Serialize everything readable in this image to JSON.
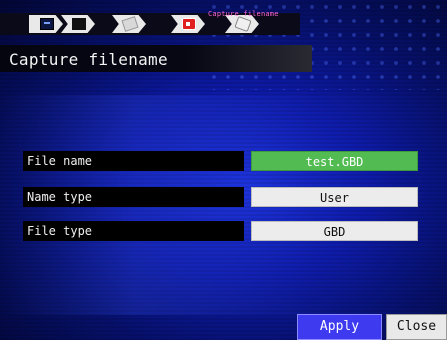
{
  "breadcrumb": {
    "caption": "Capture filename",
    "steps": [
      {
        "icon": "monitor-icon"
      },
      {
        "icon": "display-icon"
      },
      {
        "icon": "paper-icon"
      },
      {
        "icon": "record-icon"
      },
      {
        "icon": "tag-icon"
      }
    ]
  },
  "page": {
    "title": "Capture filename"
  },
  "settings": {
    "file_name": {
      "label": "File name",
      "value": "test.GBD"
    },
    "name_type": {
      "label": "Name type",
      "value": "User"
    },
    "file_type": {
      "label": "File type",
      "value": "GBD"
    }
  },
  "actions": {
    "apply_label": "Apply",
    "close_label": "Close"
  },
  "colors": {
    "accent_apply": "#3d3af0",
    "value_highlight": "#52bc52",
    "caption": "#ff66d6"
  }
}
